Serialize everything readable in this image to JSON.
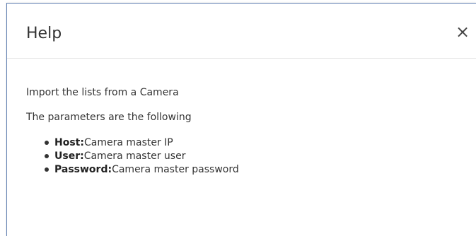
{
  "dialog": {
    "title": "Help",
    "close_glyph": "×"
  },
  "body": {
    "intro": "Import the lists from a Camera",
    "params_heading": "The parameters are the following",
    "params": [
      {
        "name": "Host:",
        "description": "Camera master IP"
      },
      {
        "name": "User:",
        "description": "Camera master user"
      },
      {
        "name": "Password:",
        "description": "Camera master password"
      }
    ]
  },
  "icons": {
    "close": "close-icon",
    "bullet": "bullet-icon"
  }
}
